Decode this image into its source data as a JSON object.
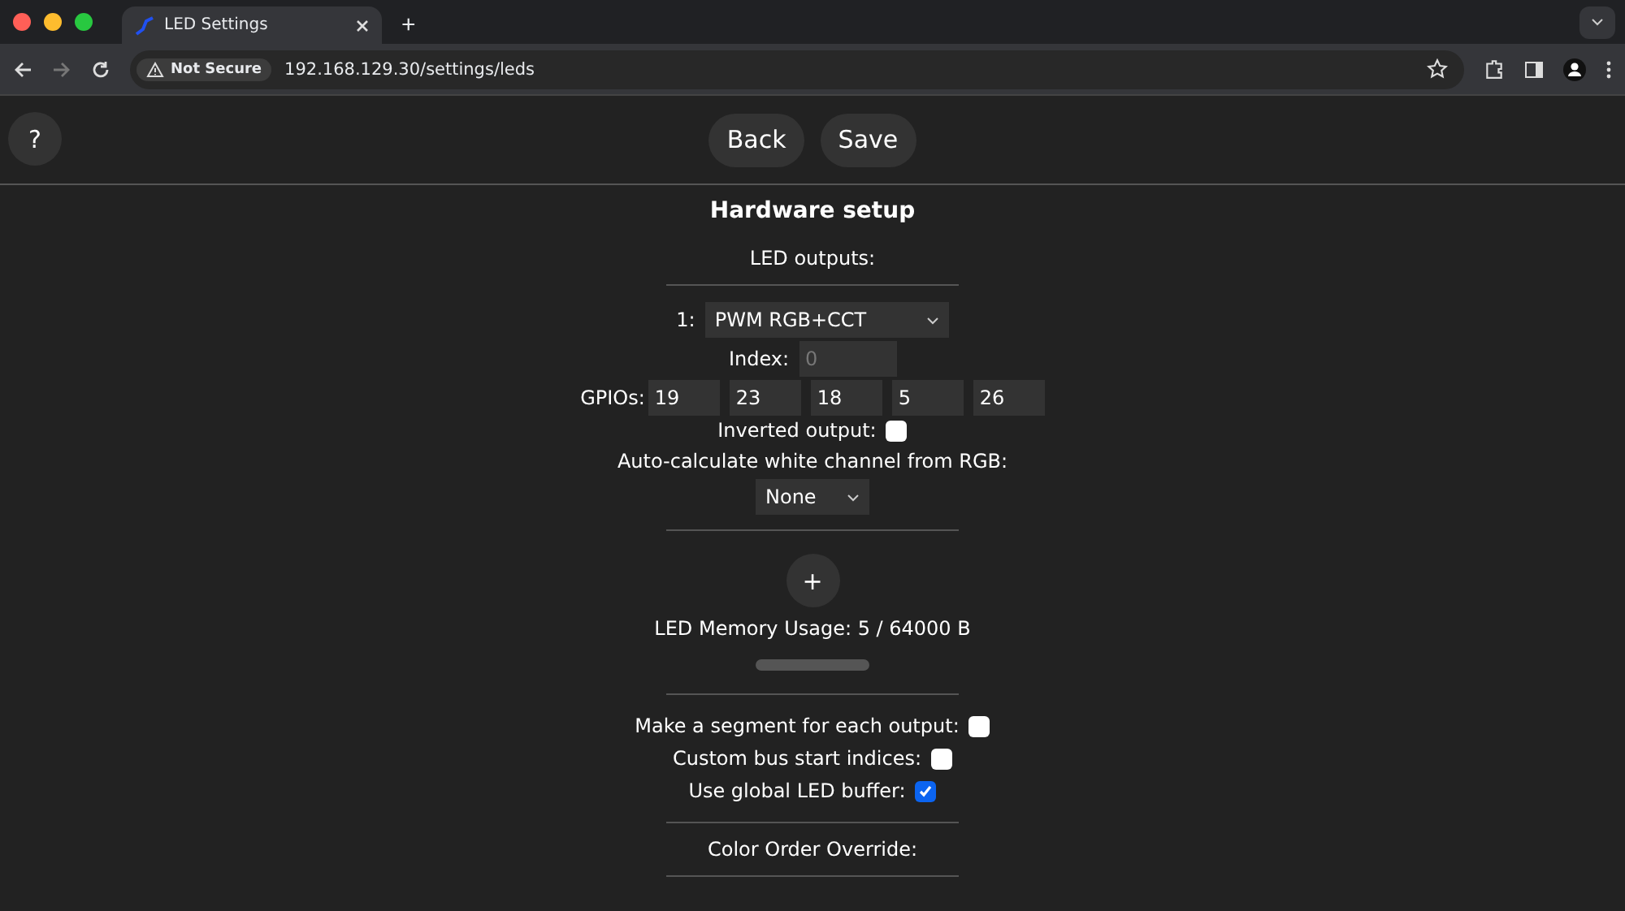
{
  "browser": {
    "tab_title": "LED Settings",
    "new_tab": "+",
    "security": "Not Secure",
    "url": "192.168.129.30/settings/leds"
  },
  "header": {
    "help": "?",
    "buttons": [
      "Back",
      "Save"
    ]
  },
  "title": "Hardware setup",
  "outputs_label": "LED outputs:",
  "output": {
    "number": "1:",
    "type": "PWM RGB+CCT",
    "index_label": "Index:",
    "index_placeholder": "0",
    "gpios_label": "GPIOs:",
    "gpios": [
      "19",
      "23",
      "18",
      "5",
      "26"
    ],
    "inverted_label": "Inverted output:",
    "inverted": false,
    "white_label": "Auto-calculate white channel from RGB:",
    "white_mode": "None"
  },
  "add": "+",
  "memory": {
    "label": "LED Memory Usage: 5 / 64000 B"
  },
  "options": [
    {
      "label": "Make a segment for each output:",
      "checked": false
    },
    {
      "label": "Custom bus start indices:",
      "checked": false
    },
    {
      "label": "Use global LED buffer:",
      "checked": true
    }
  ],
  "color_order_label": "Color Order Override:"
}
